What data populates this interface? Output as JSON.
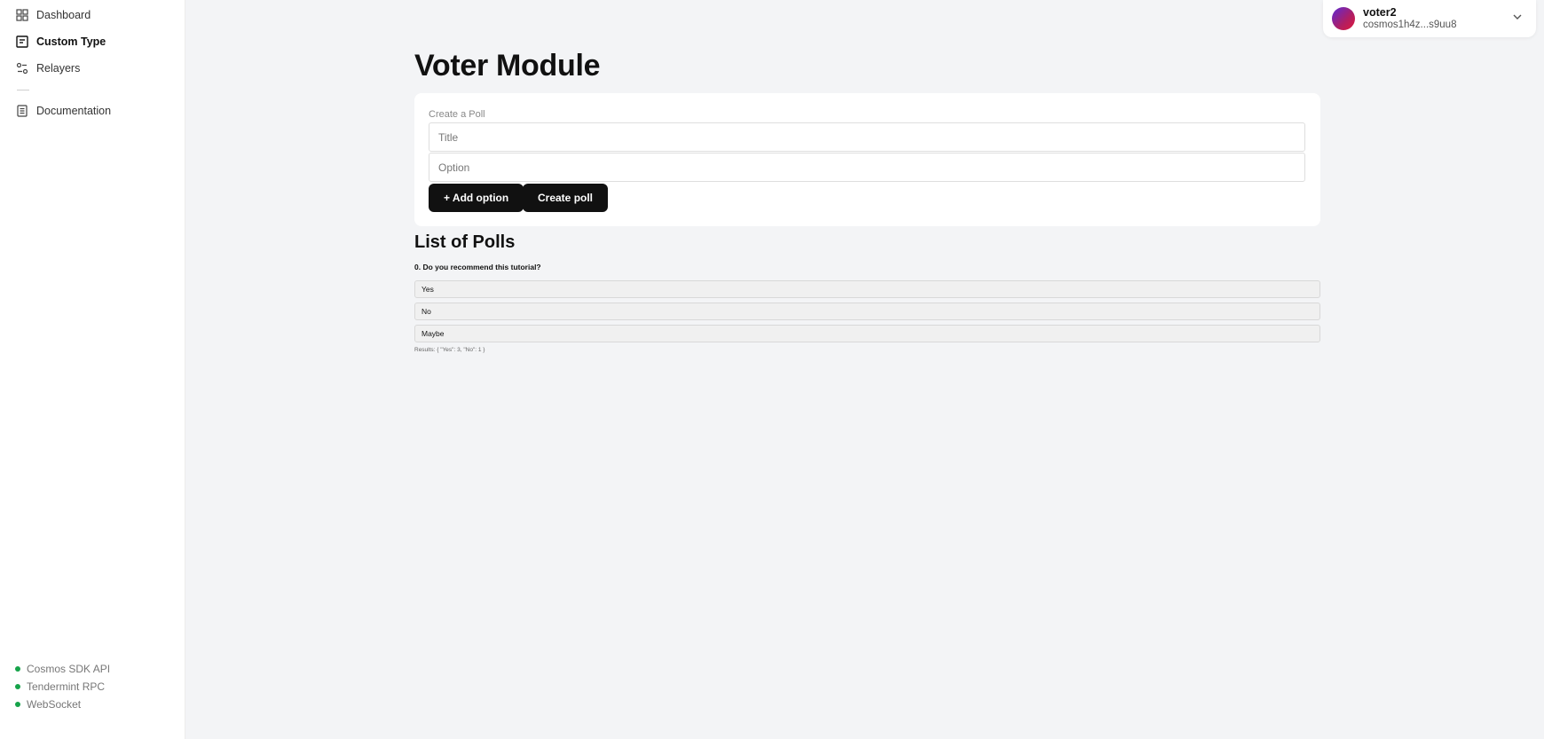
{
  "sidebar": {
    "nav": [
      {
        "label": "Dashboard",
        "icon": "grid-icon"
      },
      {
        "label": "Custom Type",
        "icon": "list-icon"
      },
      {
        "label": "Relayers",
        "icon": "relayers-icon"
      },
      {
        "label": "Documentation",
        "icon": "document-icon"
      }
    ],
    "status": [
      {
        "label": "Cosmos SDK API",
        "state": "online"
      },
      {
        "label": "Tendermint RPC",
        "state": "online"
      },
      {
        "label": "WebSocket",
        "state": "online"
      }
    ],
    "status_color": "#16a34a"
  },
  "account": {
    "name": "voter2",
    "address": "cosmos1h4z...s9uu8"
  },
  "main": {
    "title": "Voter Module",
    "create_poll": {
      "label": "Create a Poll",
      "title_placeholder": "Title",
      "option_placeholder": "Option",
      "add_option_label": "+ Add option",
      "create_label": "Create poll"
    },
    "polls_heading": "List of Polls",
    "polls": [
      {
        "question": "0. Do you recommend this tutorial?",
        "options": [
          "Yes",
          "No",
          "Maybe"
        ],
        "results": "Results: { \"Yes\": 3, \"No\": 1 }"
      }
    ]
  }
}
